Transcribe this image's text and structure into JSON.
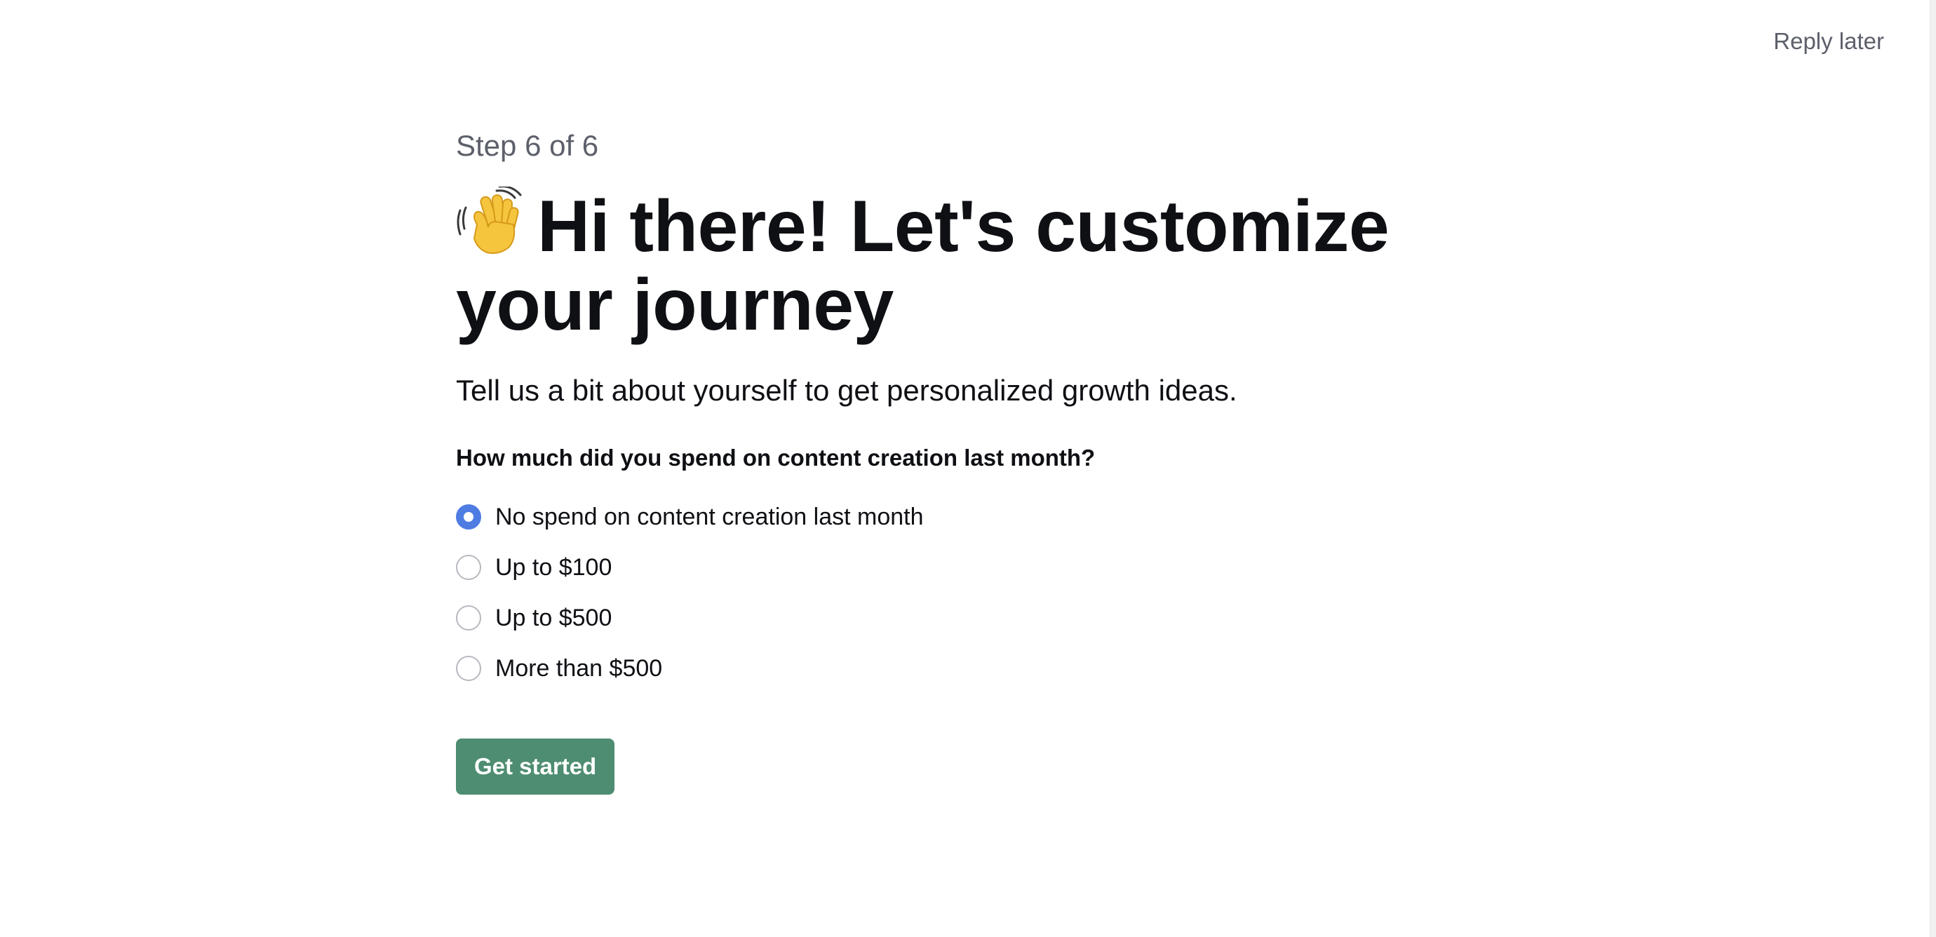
{
  "header": {
    "reply_later_label": "Reply later"
  },
  "onboarding": {
    "step_text": "Step 6 of 6",
    "title_emoji": "waving-hand-icon",
    "title": "Hi there! Let's customize your journey",
    "subtitle": "Tell us a bit about yourself to get personalized growth ideas.",
    "question": "How much did you spend on content creation last month?",
    "options": [
      {
        "label": "No spend on content creation last month",
        "selected": true
      },
      {
        "label": "Up to $100",
        "selected": false
      },
      {
        "label": "Up to $500",
        "selected": false
      },
      {
        "label": "More than $500",
        "selected": false
      }
    ],
    "cta_label": "Get started"
  },
  "colors": {
    "accent_radio": "#4f7ce2",
    "cta_background": "#4e8d71",
    "muted_text": "#5d606a",
    "primary_text": "#0f1014"
  }
}
